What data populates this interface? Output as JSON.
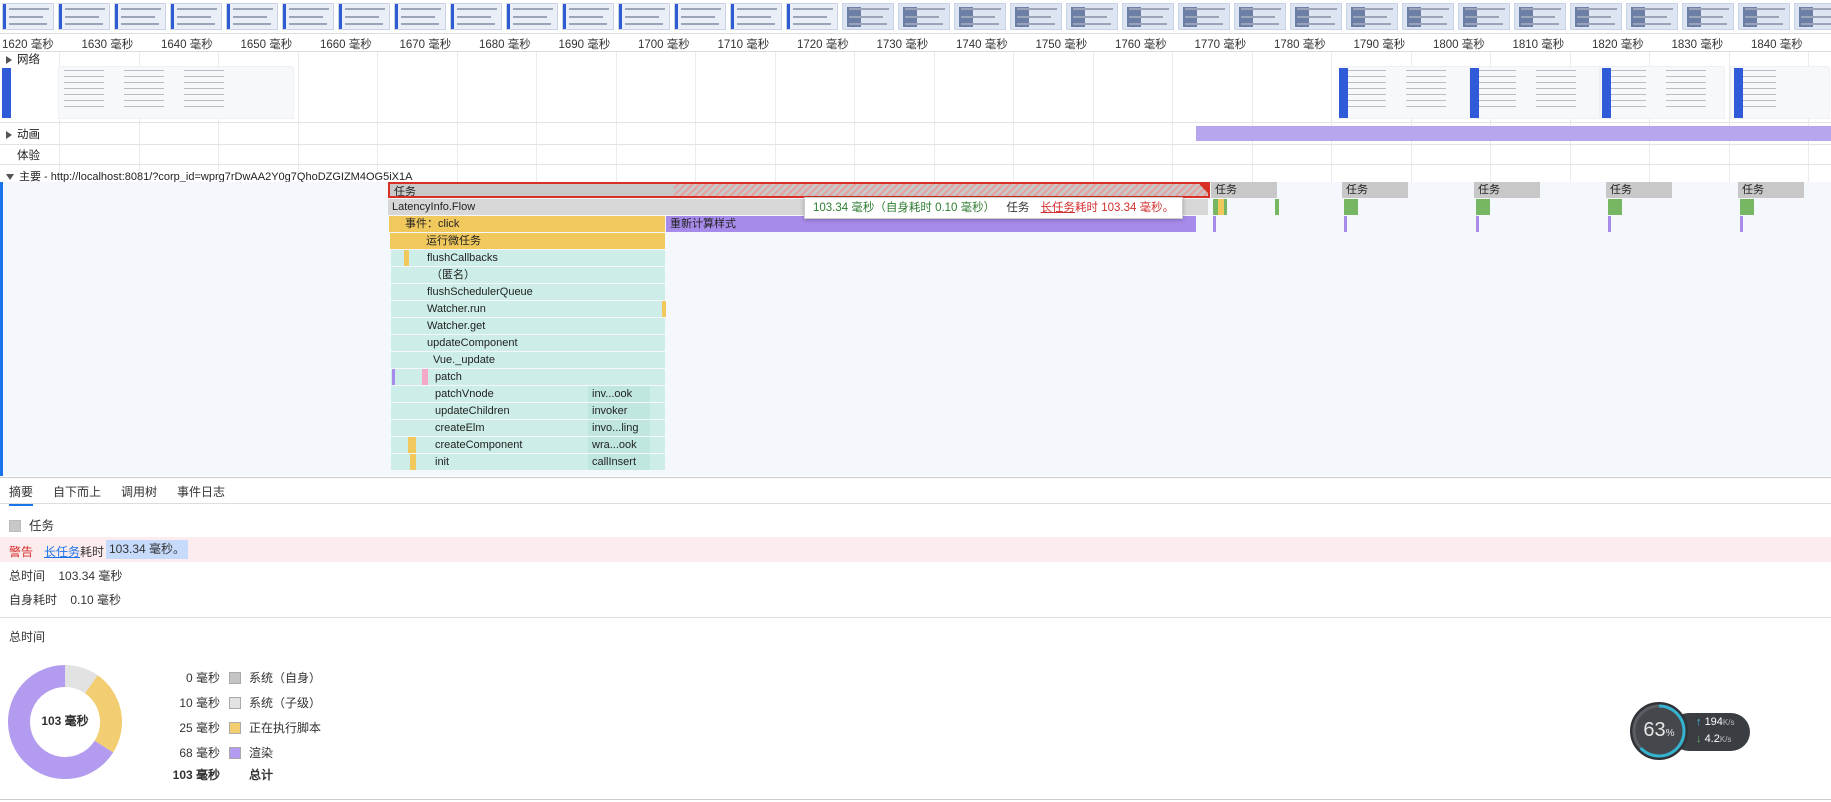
{
  "ruler": {
    "ticks": [
      "1620 毫秒",
      "1630 毫秒",
      "1640 毫秒",
      "1650 毫秒",
      "1660 毫秒",
      "1670 毫秒",
      "1680 毫秒",
      "1690 毫秒",
      "1700 毫秒",
      "1710 毫秒",
      "1720 毫秒",
      "1730 毫秒",
      "1740 毫秒",
      "1750 毫秒",
      "1760 毫秒",
      "1770 毫秒",
      "1780 毫秒",
      "1790 毫秒",
      "1800 毫秒",
      "1810 毫秒",
      "1820 毫秒",
      "1830 毫秒",
      "1840 毫秒"
    ]
  },
  "tracks": {
    "network": "网络",
    "animation": "动画",
    "experience": "体验",
    "main": "主要 - http://localhost:8081/?corp_id=wprg7rDwAA2Y0g7QhoDZGIZM4OG5iX1A"
  },
  "flame": {
    "task": "任务",
    "latency": "LatencyInfo.Flow",
    "event_click": "事件：click",
    "recalc_style": "重新计算样式",
    "microtask": "运行微任务",
    "stack": [
      "flushCallbacks",
      "（匿名）",
      "flushSchedulerQueue",
      "Watcher.run",
      "Watcher.get",
      "updateComponent",
      "Vue._update",
      "patch",
      "patchVnode",
      "updateChildren",
      "createElm",
      "createComponent",
      "init"
    ],
    "side_stack": [
      "inv...ook",
      "invoker",
      "invo...ling",
      "wra...ook",
      "callInsert"
    ],
    "small_tasks": [
      "任务",
      "任务",
      "任务",
      "任务",
      "任务"
    ]
  },
  "tooltip": {
    "duration": "103.34 毫秒（自身耗时 0.10 毫秒）",
    "name": "任务",
    "long_task_link": "长任务",
    "long_task_rest": "耗时 103.34 毫秒。"
  },
  "bottom_tabs": [
    "摘要",
    "自下而上",
    "调用树",
    "事件日志"
  ],
  "summary": {
    "title": "任务",
    "warning_label": "警告",
    "warning_link": "长任务",
    "warning_mid": "耗时",
    "warning_value": "103.34 毫秒。",
    "total_time_label": "总时间",
    "total_time_value": "103.34 毫秒",
    "self_time_label": "自身耗时",
    "self_time_value": "0.10 毫秒",
    "breakdown_title": "总时间",
    "donut_center": "103 毫秒",
    "legend": [
      {
        "value": "0 毫秒",
        "label": "系统（自身）",
        "color": "#c4c4c4"
      },
      {
        "value": "10 毫秒",
        "label": "系统（子级）",
        "color": "#e2e2e2"
      },
      {
        "value": "25 毫秒",
        "label": "正在执行脚本",
        "color": "#f2cd72"
      },
      {
        "value": "68 毫秒",
        "label": "渲染",
        "color": "#b39cef"
      }
    ],
    "total_value": "103 毫秒",
    "total_label": "总计"
  },
  "widget": {
    "percent": "63",
    "percent_unit": "%",
    "up_speed": "194",
    "down_speed": "4.2",
    "speed_unit": "K/s"
  },
  "colors": {
    "accent": "#1a73e8",
    "warning_red": "#d32f2f",
    "scripting": "#f0c85c",
    "rendering": "#a78bea"
  }
}
